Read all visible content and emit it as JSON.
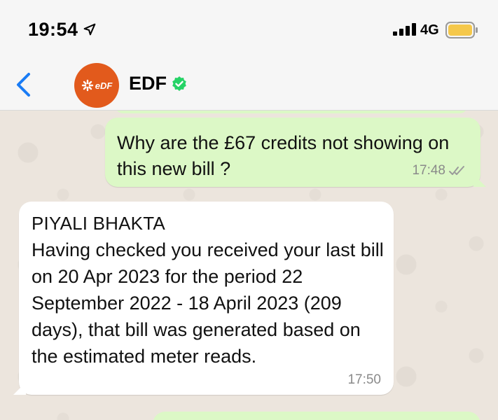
{
  "status_bar": {
    "time": "19:54",
    "network": "4G",
    "icons": [
      "location-arrow-icon",
      "signal-bars-icon",
      "battery-icon"
    ],
    "battery_color": "#f5c84b"
  },
  "header": {
    "contact_name": "EDF",
    "avatar_label": "eDF",
    "avatar_color": "#e25a1c",
    "verified_color": "#25d366",
    "icons": [
      "back-chevron-icon",
      "verified-badge-icon"
    ]
  },
  "messages": [
    {
      "direction": "outgoing",
      "text": "Why are the £67 credits not showing on this new bill ?",
      "time": "17:48",
      "status": "delivered-ticks-icon"
    },
    {
      "direction": "incoming",
      "sender": "PIYALI BHAKTA",
      "text": "Having checked you received your last bill on 20 Apr 2023 for the period 22 September 2022 - 18 April 2023 (209 days), that bill was generated based on the estimated meter reads.",
      "time": "17:50"
    }
  ],
  "colors": {
    "outgoing_bubble": "#dcf8c6",
    "incoming_bubble": "#ffffff",
    "chat_background": "#ece5dd",
    "accent_blue": "#1a7cf5"
  }
}
